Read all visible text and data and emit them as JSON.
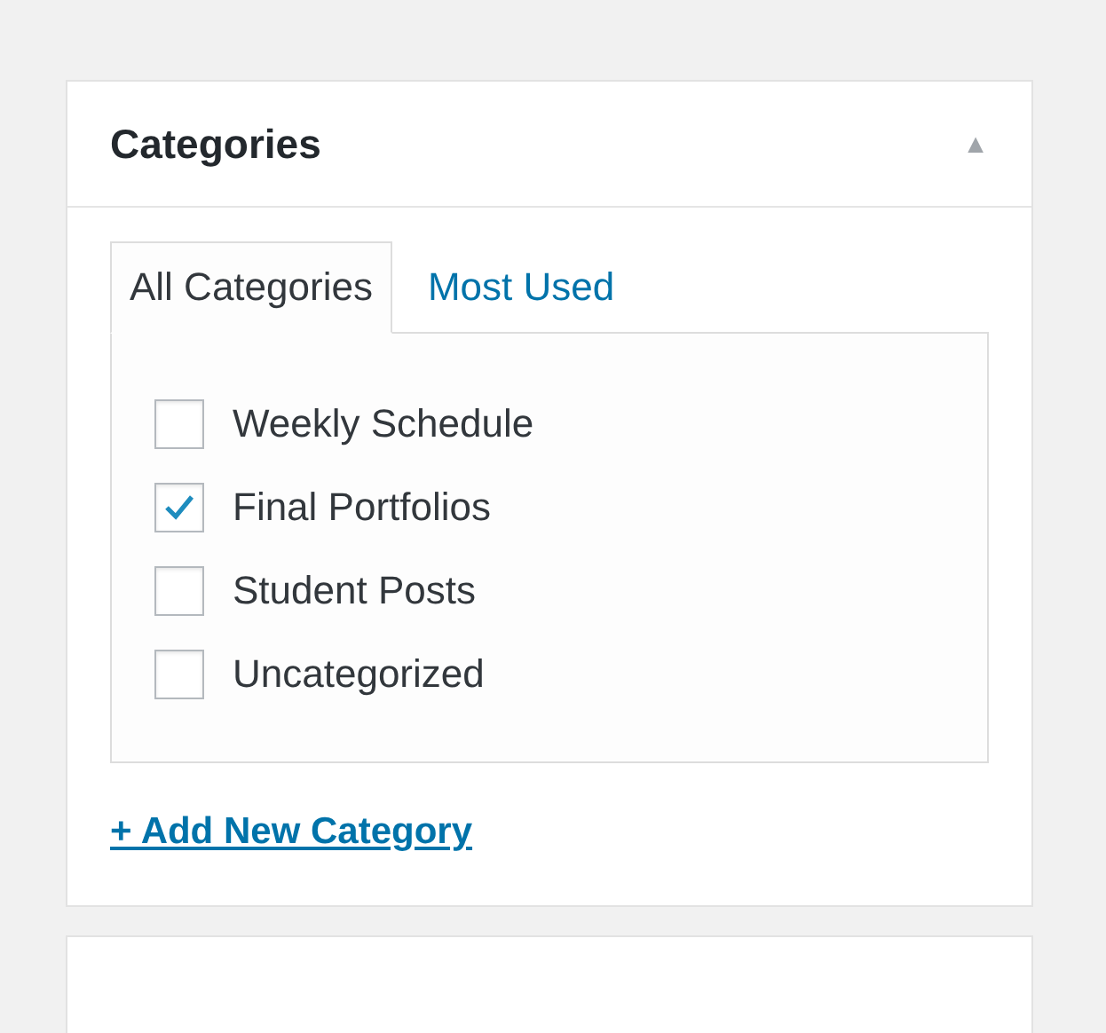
{
  "metabox": {
    "title": "Categories",
    "collapse_icon": "▲",
    "tabs": [
      {
        "label": "All Categories",
        "selected": true
      },
      {
        "label": "Most Used",
        "selected": false
      }
    ],
    "categories": [
      {
        "label": "Weekly Schedule",
        "checked": false
      },
      {
        "label": "Final Portfolios",
        "checked": true
      },
      {
        "label": "Student Posts",
        "checked": false
      },
      {
        "label": "Uncategorized",
        "checked": false
      }
    ],
    "add_link": "+ Add New Category"
  }
}
